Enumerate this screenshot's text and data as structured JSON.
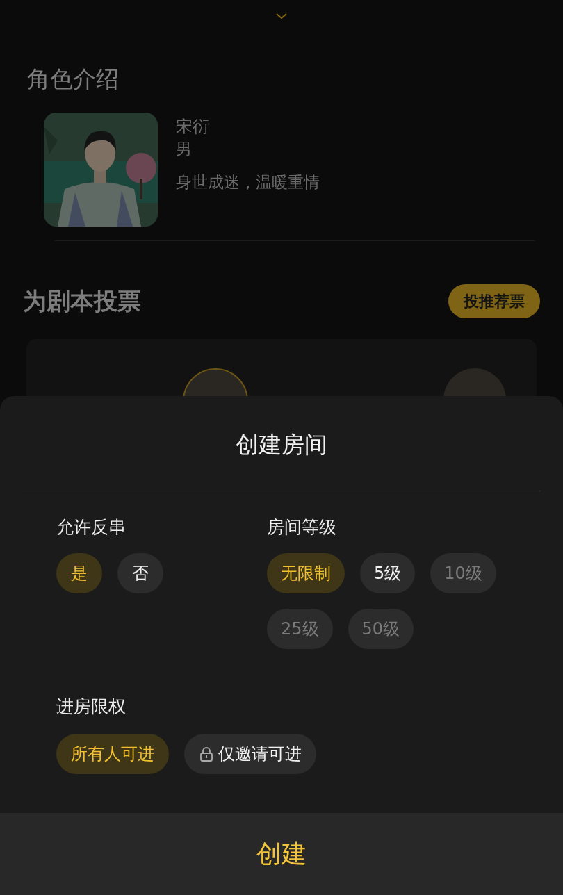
{
  "background_page": {
    "character_section": {
      "title": "角色介绍",
      "character": {
        "name": "宋衍",
        "gender": "男",
        "description": "身世成迷，温暖重情"
      }
    },
    "vote_section": {
      "title": "为剧本投票",
      "button": "投推荐票"
    }
  },
  "sheet": {
    "title": "创建房间",
    "groups": [
      {
        "label": "允许反串",
        "options": [
          {
            "label": "是",
            "selected": true,
            "disabled": false
          },
          {
            "label": "否",
            "selected": false,
            "disabled": false
          }
        ]
      },
      {
        "label": "房间等级",
        "options": [
          {
            "label": "无限制",
            "selected": true,
            "disabled": false
          },
          {
            "label": "5级",
            "selected": false,
            "disabled": false
          },
          {
            "label": "10级",
            "selected": false,
            "disabled": true
          },
          {
            "label": "25级",
            "selected": false,
            "disabled": true
          },
          {
            "label": "50级",
            "selected": false,
            "disabled": true
          }
        ]
      },
      {
        "label": "进房限权",
        "options": [
          {
            "label": "所有人可进",
            "selected": true,
            "disabled": false,
            "locked": false
          },
          {
            "label": "仅邀请可进",
            "selected": false,
            "disabled": false,
            "locked": true
          }
        ]
      }
    ],
    "confirm_button": "创建"
  }
}
